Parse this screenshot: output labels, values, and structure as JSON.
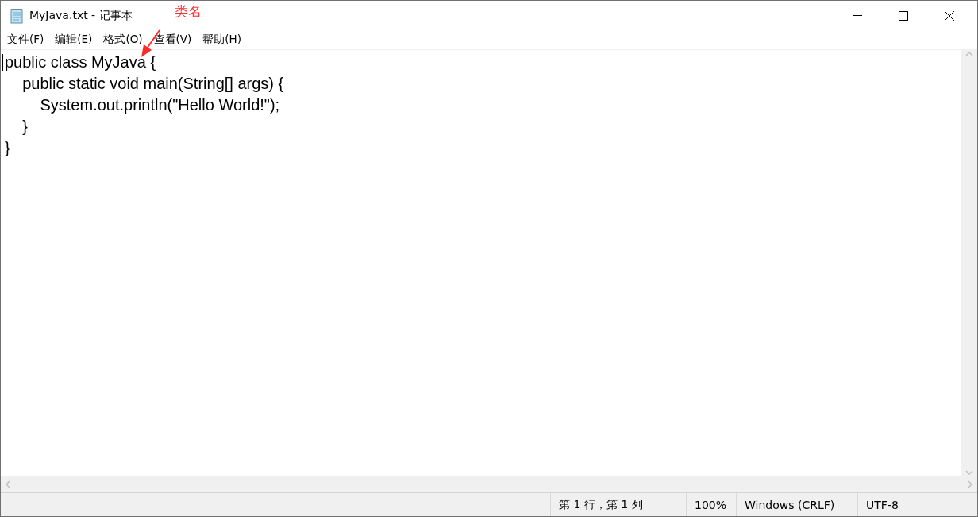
{
  "window": {
    "title": "MyJava.txt - 记事本"
  },
  "menu": [
    {
      "label": "文件(F)"
    },
    {
      "label": "编辑(E)"
    },
    {
      "label": "格式(O)"
    },
    {
      "label": "查看(V)"
    },
    {
      "label": "帮助(H)"
    }
  ],
  "editor": {
    "lines": [
      "public class MyJava {",
      "    public static void main(String[] args) {",
      "        System.out.println(\"Hello World!\");",
      "    }",
      "}"
    ]
  },
  "annotation": {
    "text": "类名"
  },
  "status_bar": [
    "第 1 行，第 1 列",
    "100%",
    "Windows (CRLF)",
    "UTF-8"
  ]
}
